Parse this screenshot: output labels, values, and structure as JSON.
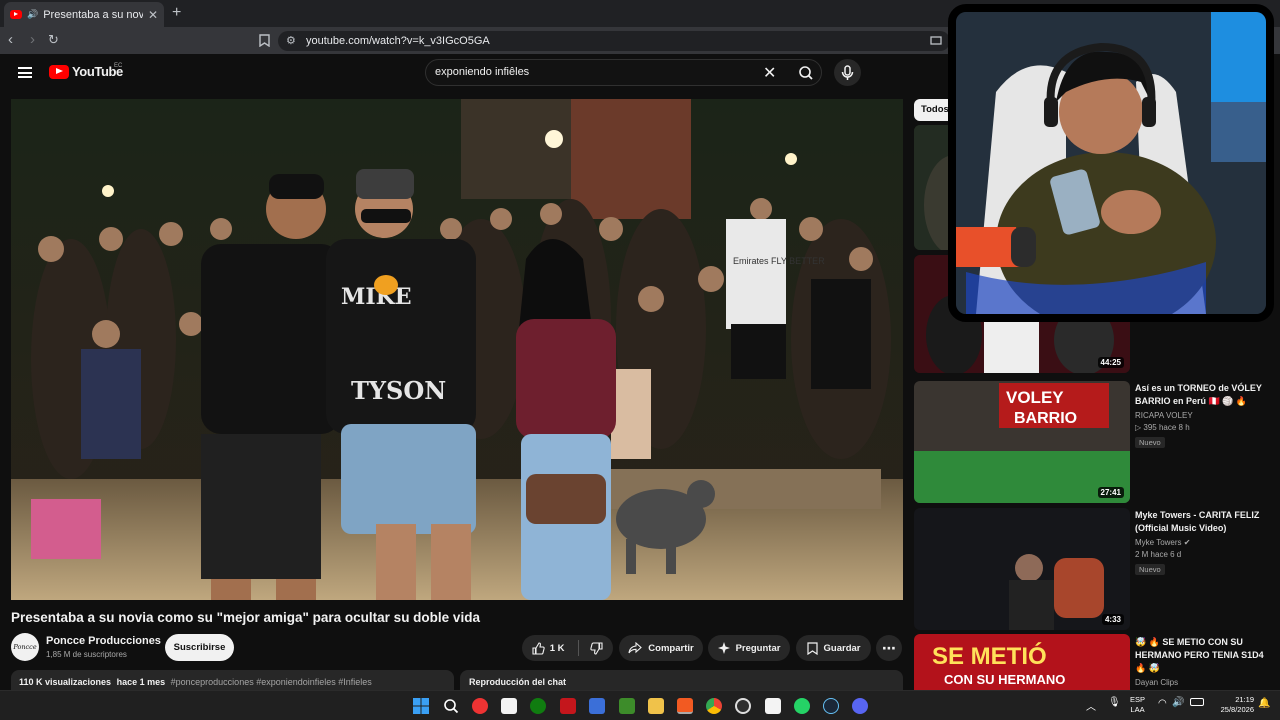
{
  "browser": {
    "tab_title": "Presentaba a su novia como",
    "url": "youtube.com/watch?v=k_v3IGcO5GA"
  },
  "header": {
    "logo_text": "YouTube",
    "country": "EC",
    "search_value": "exponiendo infiêles"
  },
  "video": {
    "title": "Presentaba a su novia como su \"mejor amiga\" para ocultar su doble vida",
    "channel": "Poncce Producciones",
    "subscribers": "1,85 M de suscriptores",
    "avatar_text": "Poncce",
    "subscribe_label": "Suscribirse",
    "likes": "1 K",
    "share_label": "Compartir",
    "ask_label": "Preguntar",
    "save_label": "Guardar",
    "views": "110 K visualizaciones",
    "age": "hace 1 mes",
    "tags": "#ponceproducciones #exponiendoinfieles #Infieles",
    "chat_label": "Reproducción del chat",
    "shirt_text_1": "MIKE",
    "shirt_text_2": "TYSON",
    "jersey_text": "Emirates FLY BETTER"
  },
  "sidebar": {
    "chip_all": "Todos",
    "items": [
      {
        "title": "",
        "channel": "",
        "meta": "",
        "duration": ""
      },
      {
        "title": "",
        "channel": "",
        "meta": "",
        "duration": "44:25"
      },
      {
        "title": "Así es un TORNEO de VÓLEY BARRIO en Perú 🇵🇪 🏐 🔥",
        "channel": "RICAPA VOLEY",
        "meta": "▷ 395  hace 8 h",
        "badge": "Nuevo",
        "duration": "27:41",
        "thumb_text_1": "VOLEY",
        "thumb_text_2": "BARRIO"
      },
      {
        "title": "Myke Towers - CARITA FELIZ (Official Music Video)",
        "channel": "Myke Towers ✔",
        "meta": "2 M  hace 6 d",
        "badge": "Nuevo",
        "duration": "4:33"
      },
      {
        "title": "🤯 🔥 SE METIO CON SU HERMANO PERO TENIA S1D4 🔥 🤯",
        "channel": "Dayan Clips",
        "meta": "",
        "duration": "",
        "thumb_text_1": "SE METIÓ",
        "thumb_text_2": "CON SU HERMANO"
      }
    ]
  },
  "taskbar": {
    "lang_1": "ESP",
    "lang_2": "LAA",
    "time": "21:19",
    "date": "25/8/2026"
  }
}
